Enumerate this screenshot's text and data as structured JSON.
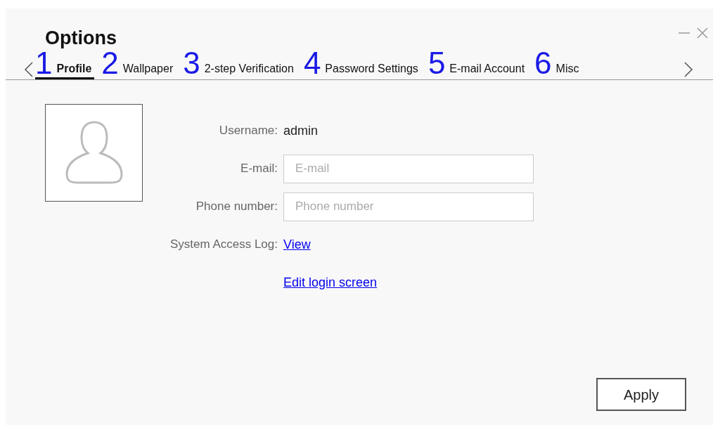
{
  "window": {
    "title": "Options"
  },
  "tabs": [
    {
      "marker": "1",
      "label": "Profile",
      "selected": true
    },
    {
      "marker": "2",
      "label": "Wallpaper",
      "selected": false
    },
    {
      "marker": "3",
      "label": "2-step Verification",
      "selected": false
    },
    {
      "marker": "4",
      "label": "Password Settings",
      "selected": false
    },
    {
      "marker": "5",
      "label": "E-mail Account",
      "selected": false
    },
    {
      "marker": "6",
      "label": "Misc",
      "selected": false
    }
  ],
  "profile": {
    "username_label": "Username:",
    "username": "admin",
    "email_label": "E-mail:",
    "email": {
      "placeholder": "E-mail"
    },
    "phone_label": "Phone number:",
    "phone": {
      "placeholder": "Phone number"
    },
    "log_label": "System Access Log:",
    "log_link": "View",
    "edit_link": "Edit login screen"
  },
  "buttons": [
    "Apply"
  ]
}
